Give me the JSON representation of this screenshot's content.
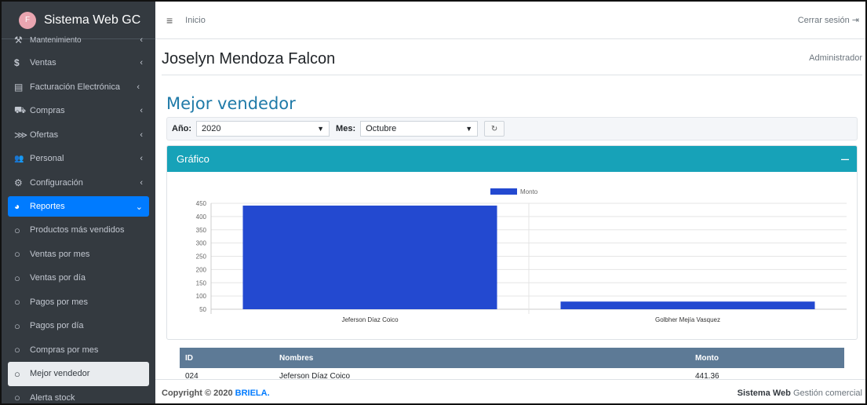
{
  "brand": {
    "title": "Sistema Web GC",
    "logo_text": "F"
  },
  "sidebar": {
    "items": [
      {
        "label": "Mantenimiento",
        "icon": "wrench-icon",
        "glyph": "⚒",
        "chevron": "‹"
      },
      {
        "label": "Ventas",
        "icon": "dollar-icon",
        "glyph": "$",
        "chevron": "‹"
      },
      {
        "label": "Facturación Electrónica",
        "icon": "invoice-icon",
        "glyph": "▤",
        "chevron": "‹"
      },
      {
        "label": "Compras",
        "icon": "cart-icon",
        "glyph": "⛟",
        "chevron": "‹"
      },
      {
        "label": "Ofertas",
        "icon": "tags-icon",
        "glyph": "⋙",
        "chevron": "‹"
      },
      {
        "label": "Personal",
        "icon": "users-icon",
        "glyph": "👥",
        "chevron": "‹"
      },
      {
        "label": "Configuración",
        "icon": "cog-icon",
        "glyph": "⚙",
        "chevron": "‹"
      },
      {
        "label": "Reportes",
        "icon": "chart-pie-icon",
        "glyph": "◕",
        "chevron": "⌄"
      }
    ],
    "subitems": [
      {
        "label": "Productos más vendidos"
      },
      {
        "label": "Ventas por mes"
      },
      {
        "label": "Ventas por día"
      },
      {
        "label": "Pagos por mes"
      },
      {
        "label": "Pagos por día"
      },
      {
        "label": "Compras por mes"
      },
      {
        "label": "Mejor vendedor"
      },
      {
        "label": "Alerta stock"
      }
    ]
  },
  "topbar": {
    "home": "Inicio",
    "logout": "Cerrar sesión",
    "menu_glyph": "≡",
    "logout_glyph": "⇥"
  },
  "user": {
    "name": "Joselyn Mendoza Falcon",
    "role": "Administrador"
  },
  "section_title": "Mejor vendedor",
  "filter": {
    "year_label": "Año:",
    "year_value": "2020",
    "month_label": "Mes:",
    "month_value": "Octubre",
    "refresh_glyph": "↻"
  },
  "card": {
    "title": "Gráfico",
    "collapse_glyph": "–"
  },
  "chart_data": {
    "type": "bar",
    "categories": [
      "Jeferson Díaz Coico",
      "Golbher Mejía Vasquez"
    ],
    "series": [
      {
        "name": "Monto",
        "values": [
          441.36,
          79
        ],
        "color": "#2349d0"
      }
    ],
    "ylim": [
      50,
      450
    ],
    "yticks": [
      50,
      100,
      150,
      200,
      250,
      300,
      350,
      400,
      450
    ],
    "legend": "top"
  },
  "table": {
    "headers": [
      "ID",
      "Nombres",
      "Monto"
    ],
    "rows": [
      [
        "024",
        "Jeferson Díaz Coico",
        "441.36"
      ]
    ]
  },
  "footer": {
    "copyright": "Copyright © 2020",
    "brand": "BRIELA.",
    "right_bold": "Sistema Web",
    "right_text": "Gestión comercial"
  }
}
